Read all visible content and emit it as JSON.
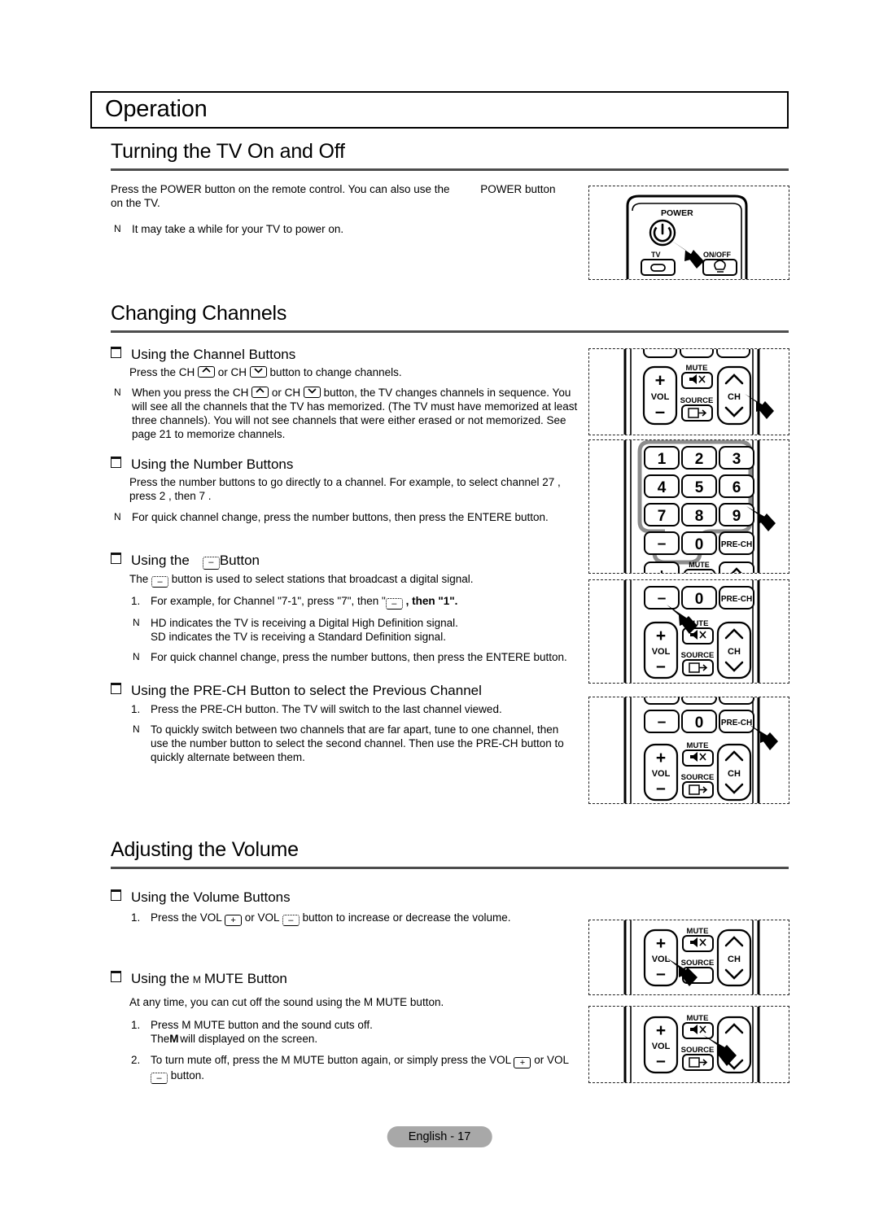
{
  "chapter": {
    "title": "Operation"
  },
  "sections": {
    "power": {
      "title": "Turning the TV On and Off",
      "para1_a": "Press the ",
      "para1_b": "POWER button on the remote control. You can also use the ",
      "para1_c": "POWER button",
      "para1_d": "on the TV.",
      "note1_mark": "N",
      "note1_text": "It may take a while for your TV to power on."
    },
    "channels": {
      "title": "Changing Channels",
      "sub1": {
        "heading": "Using the Channel Buttons",
        "line_a": "Press the CH ",
        "line_b": " or CH ",
        "line_c": " button to change channels.",
        "note_mark": "N",
        "note_a": "When you press the CH ",
        "note_b": " or CH ",
        "note_c": " button, the TV changes channels in sequence. You will see all the channels that the TV has memorized. (The TV must have memorized at least three channels). You will not see channels that were either erased or not memorized. See page 21 to memorize channels."
      },
      "sub2": {
        "heading": "Using the Number Buttons",
        "line1": "Press the number buttons to go directly to a channel. For example, to select channel  27 , press  2 , then  7 .",
        "note_mark": "N",
        "note_text": "For quick channel change, press the number buttons, then press the ENTERE button."
      },
      "sub3": {
        "heading_a": "Using the ",
        "heading_b": " Button",
        "line_a": "The ",
        "line_b": " button is used to select stations that broadcast a digital signal.",
        "item1_num": "1.",
        "item1_a": "For example, for Channel \"7-1\", press \"7\", then \"",
        "item1_b": " , then \"1\".",
        "note1_mark": "N",
        "note1_text": "HD indicates the TV is receiving a Digital High Definition signal.",
        "note1_text2": "SD indicates the TV is receiving a Standard Definition signal.",
        "note2_mark": "N",
        "note2_text": "For quick channel change, press the number buttons, then press the ENTERE button."
      },
      "sub4": {
        "heading": "Using the PRE-CH Button to select the Previous Channel",
        "item1_num": "1.",
        "item1_text": "Press the PRE-CH button. The TV will switch to the last channel viewed.",
        "note_mark": "N",
        "note_text": "To quickly switch between two channels that are far apart, tune to one channel, then use the number button to select the second channel. Then use the PRE-CH button to quickly alternate between them."
      }
    },
    "volume": {
      "title": "Adjusting the Volume",
      "sub1": {
        "heading": "Using the Volume Buttons",
        "item1_num": "1.",
        "item1_a": "Press the VOL ",
        "item1_b": " or VOL ",
        "item1_c": " button to increase or decrease the volume."
      },
      "sub2": {
        "heading_a": "Using the ",
        "heading_m": "M",
        "heading_b": " MUTE Button",
        "line1": "At any time, you can cut off the sound using the M MUTE button.",
        "item1_num": "1.",
        "item1_text": "Press M MUTE button and the sound cuts off.",
        "item1_text2_a": "The",
        "item1_text2_m": "M",
        "item1_text2_b": " will displayed on the screen.",
        "item2_num": "2.",
        "item2_a": "To turn mute off, press the M MUTE button again, or simply press the VOL ",
        "item2_b": " or VOL ",
        "item2_c": " button."
      }
    }
  },
  "remote_labels": {
    "power": "POWER",
    "tv": "TV",
    "onoff": "ON/OFF",
    "vol": "VOL",
    "mute": "MUTE",
    "source": "SOURCE",
    "ch": "CH",
    "prech": "PRE-CH",
    "plus": "+",
    "minus": "−",
    "keys": [
      "1",
      "2",
      "3",
      "4",
      "5",
      "6",
      "7",
      "8",
      "9",
      "−",
      "0"
    ]
  },
  "footer": {
    "page_label": "English - 17"
  },
  "colors": {
    "rule": "#4d4d4d",
    "footer_bg": "#a8a8a8",
    "ink": "#000000",
    "keypad_ring": "#8c8c8c"
  }
}
